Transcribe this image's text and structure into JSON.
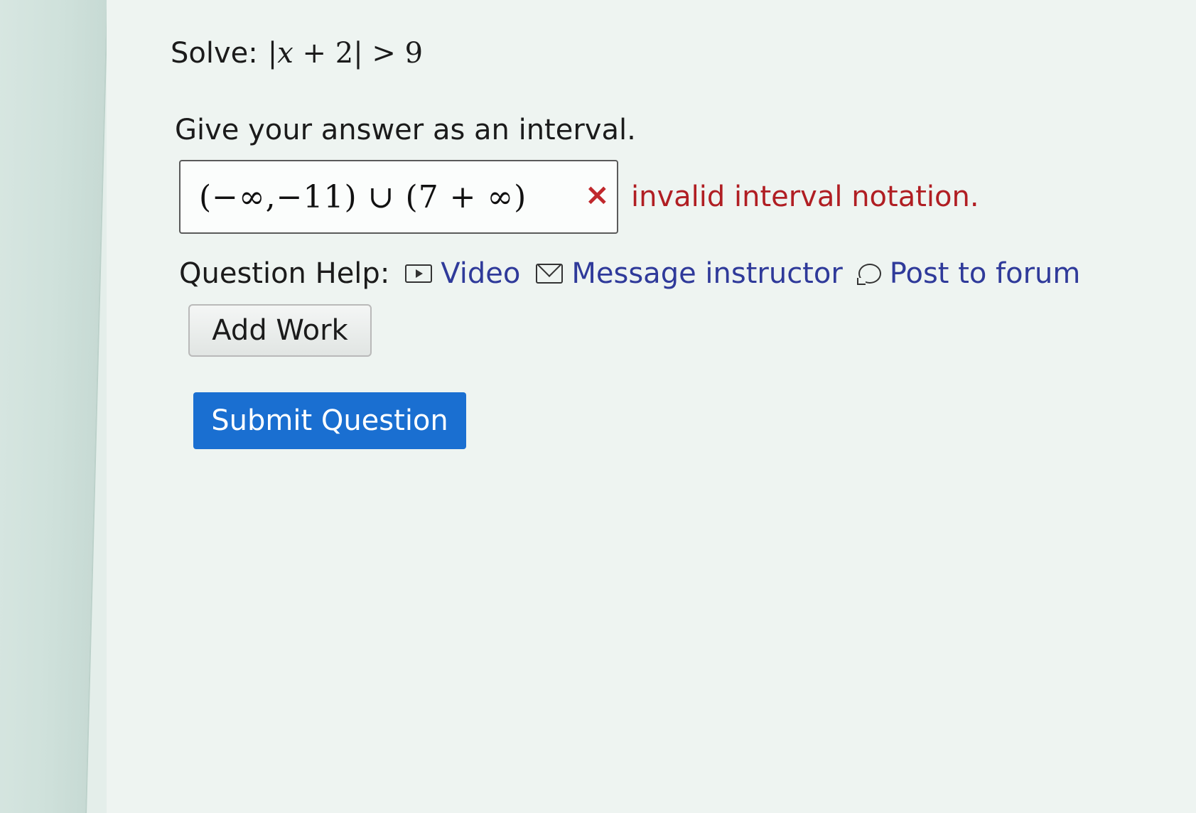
{
  "problem": {
    "label": "Solve:",
    "expression": {
      "bar_left": "|",
      "variable": "x",
      "rest": " + 2",
      "bar_right": "|",
      "relation": " > 9"
    }
  },
  "instruction": "Give your answer as an interval.",
  "answer": {
    "value": "(−∞,−11) ∪ (7 + ∞)",
    "status_icon": "×",
    "feedback": "invalid interval notation."
  },
  "question_help": {
    "label": "Question Help:",
    "links": [
      {
        "label": "Video",
        "icon": "video-icon"
      },
      {
        "label": "Message instructor",
        "icon": "mail-icon"
      },
      {
        "label": "Post to forum",
        "icon": "forum-icon"
      }
    ]
  },
  "buttons": {
    "add_work": "Add Work",
    "submit": "Submit Question"
  },
  "colors": {
    "error": "#b01e23",
    "link": "#2f3a9a",
    "submit_bg": "#1a6fd1"
  }
}
